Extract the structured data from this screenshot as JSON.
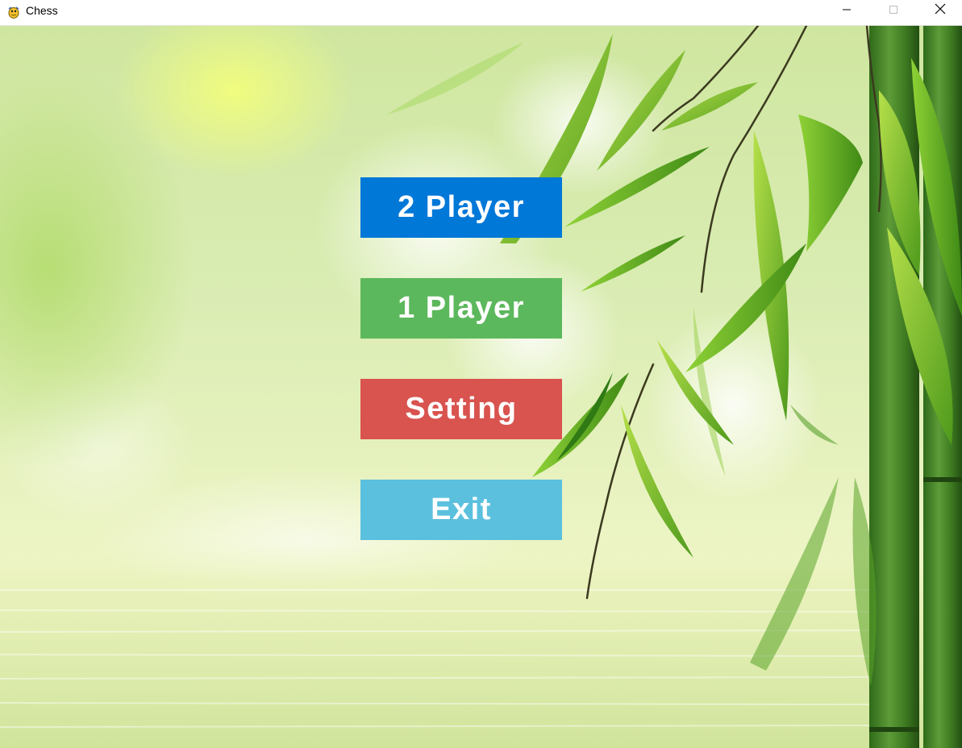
{
  "window": {
    "title": "Chess",
    "app_icon": "pygame-snake-icon",
    "controls": {
      "minimize_icon": "minimize-icon",
      "maximize_icon": "maximize-icon",
      "close_icon": "close-icon"
    }
  },
  "background": {
    "description_icon": "bamboo-water-background"
  },
  "menu": {
    "buttons": [
      {
        "label": "2 Player",
        "color": "#0078d8"
      },
      {
        "label": "1 Player",
        "color": "#5cb85c"
      },
      {
        "label": "Setting",
        "color": "#d9534f"
      },
      {
        "label": "Exit",
        "color": "#5bc0de"
      }
    ]
  }
}
